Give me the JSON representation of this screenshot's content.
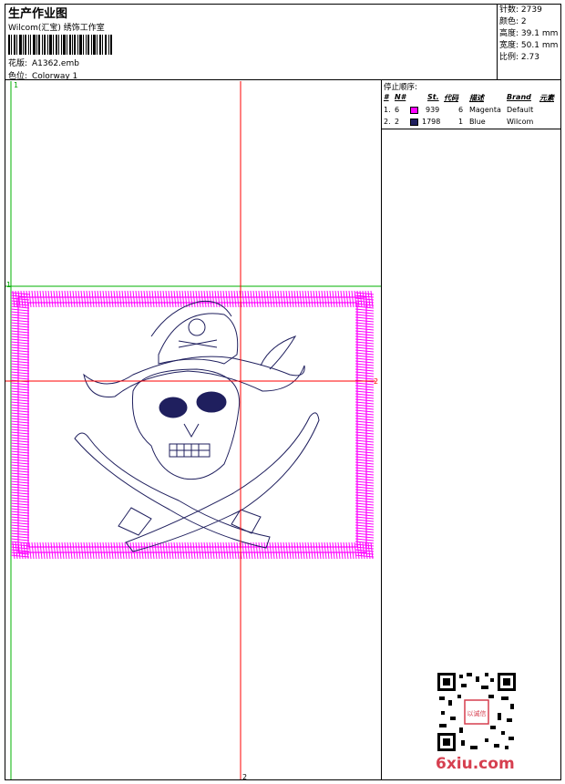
{
  "header": {
    "title": "生产作业图",
    "company": "Wilcom(汇宝) 绣饰工作室",
    "design_label": "花版:",
    "design_value": "A1362.emb",
    "colorway_label": "色位:",
    "colorway_value": "Colorway 1"
  },
  "stats": [
    {
      "label": "针数:",
      "value": "2739"
    },
    {
      "label": "颜色:",
      "value": "2"
    },
    {
      "label": "高度:",
      "value": "39.1 mm"
    },
    {
      "label": "宽度:",
      "value": "50.1 mm"
    },
    {
      "label": "比例:",
      "value": "2.73"
    }
  ],
  "stop_sequence": {
    "title": "停止顺序:",
    "columns": [
      "#",
      "N#",
      "St.",
      "代码",
      "描述",
      "Brand",
      "元素"
    ],
    "rows": [
      {
        "idx": "1.",
        "n": "6",
        "color": "#ff00ff",
        "st": "939",
        "code": "6",
        "desc": "Magenta",
        "brand": "Default",
        "elem": ""
      },
      {
        "idx": "2.",
        "n": "2",
        "color": "#1f1f5e",
        "st": "1798",
        "code": "1",
        "desc": "Blue",
        "brand": "Wilcom",
        "elem": ""
      }
    ]
  },
  "guides": {
    "marker_1": "1",
    "marker_2": "2",
    "center_marker_1": "1",
    "center_marker_2": "2"
  },
  "colors": {
    "border_stitch": "#ff00ff",
    "design_stitch": "#1f1f5e",
    "guide_red": "#ff0000",
    "guide_green": "#00b000"
  },
  "watermark": "6xiu.com",
  "qr_stamp_text": "以诚信"
}
